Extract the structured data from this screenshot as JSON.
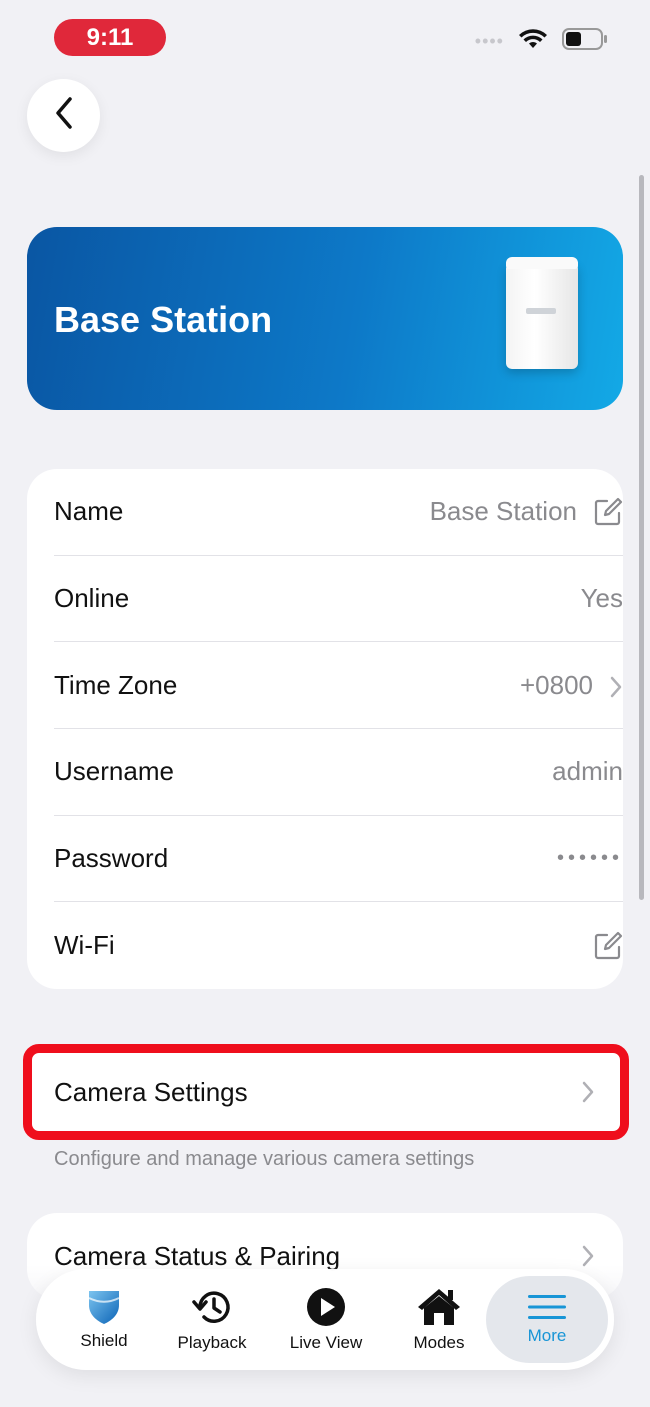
{
  "status_bar": {
    "time": "9:11",
    "cellular": "••••",
    "wifi_icon": "wifi-icon",
    "battery_icon": "battery-icon"
  },
  "header": {
    "back_icon": "chevron-left-icon"
  },
  "hero": {
    "title": "Base Station",
    "device_image": "base-station-device"
  },
  "info": {
    "rows": [
      {
        "label": "Name",
        "value": "Base Station",
        "icon": "edit-icon"
      },
      {
        "label": "Online",
        "value": "Yes"
      },
      {
        "label": "Time Zone",
        "value": "+0800",
        "icon": "chevron-right-icon"
      },
      {
        "label": "Username",
        "value": "admin"
      },
      {
        "label": "Password",
        "value": "••••••"
      },
      {
        "label": "Wi-Fi",
        "value": "",
        "icon": "edit-icon"
      }
    ]
  },
  "camera_settings": {
    "label": "Camera Settings",
    "helper": "Configure and manage various camera settings"
  },
  "camera_status": {
    "label": "Camera Status & Pairing"
  },
  "tabbar": {
    "tabs": [
      {
        "label": "Shield",
        "icon": "shield-icon"
      },
      {
        "label": "Playback",
        "icon": "history-icon"
      },
      {
        "label": "Live View",
        "icon": "play-icon"
      },
      {
        "label": "Modes",
        "icon": "home-icon"
      },
      {
        "label": "More",
        "icon": "menu-icon",
        "active": true
      }
    ]
  },
  "colors": {
    "accent": "#1795d6",
    "highlight": "#ef0e1c",
    "hero_start": "#0a56a3",
    "hero_end": "#13a9e6"
  }
}
